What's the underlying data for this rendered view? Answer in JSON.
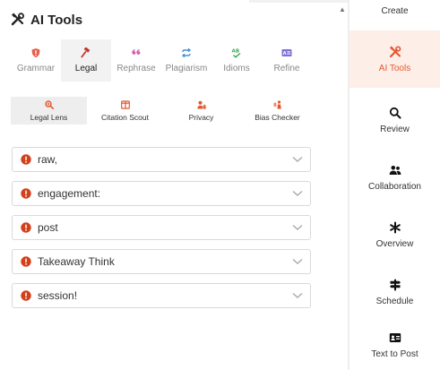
{
  "panel": {
    "title": "AI Tools"
  },
  "tabs": [
    {
      "label": "Grammar",
      "icon": "shield-icon"
    },
    {
      "label": "Legal",
      "icon": "gavel-icon",
      "active": true
    },
    {
      "label": "Rephrase",
      "icon": "quote-icon"
    },
    {
      "label": "Plagiarism",
      "icon": "repeat-icon"
    },
    {
      "label": "Idioms",
      "icon": "ab-check-icon"
    },
    {
      "label": "Refine",
      "icon": "text-box-icon"
    }
  ],
  "subtabs": [
    {
      "label": "Legal Lens",
      "icon": "magnifier-icon",
      "active": true
    },
    {
      "label": "Citation Scout",
      "icon": "columns-icon"
    },
    {
      "label": "Privacy",
      "icon": "user-lock-icon"
    },
    {
      "label": "Bias Checker",
      "icon": "scale-person-icon"
    }
  ],
  "items": [
    {
      "text": "raw,"
    },
    {
      "text": "engagement:"
    },
    {
      "text": "post"
    },
    {
      "text": "Takeaway Think"
    },
    {
      "text": "session!"
    }
  ],
  "sidebar": [
    {
      "label": "Create",
      "icon": ""
    },
    {
      "label": "AI Tools",
      "icon": "tools-icon",
      "active": true
    },
    {
      "label": "Review",
      "icon": "search-icon"
    },
    {
      "label": "Collaboration",
      "icon": "people-icon"
    },
    {
      "label": "Overview",
      "icon": "asterisk-icon"
    },
    {
      "label": "Schedule",
      "icon": "signpost-icon"
    },
    {
      "label": "Text to Post",
      "icon": "id-card-icon"
    }
  ],
  "colors": {
    "accent": "#e4572e",
    "accent_bg": "#fdeee8",
    "grammar_icon": "#e8604c",
    "legal_icon": "#c0392b",
    "rephrase_icon": "#d65db1",
    "plagiarism_icon": "#3f8fd8",
    "idioms_icon": "#3aa655",
    "refine_icon": "#7b6fd8",
    "alert": "#d2401c"
  }
}
